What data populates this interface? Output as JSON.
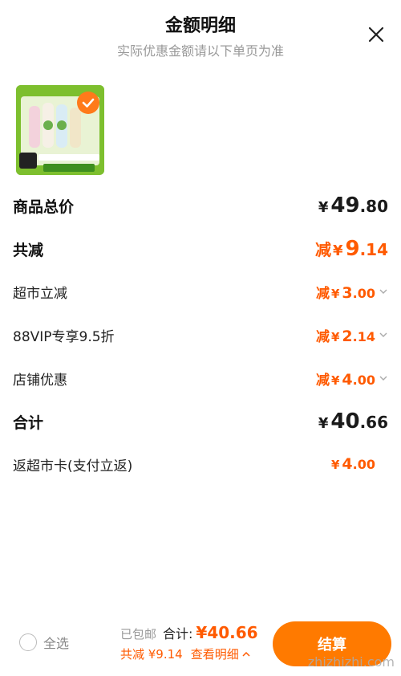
{
  "header": {
    "title": "金额明细",
    "subtitle": "实际优惠金额请以下单页为准"
  },
  "icons": {
    "close": "close-icon",
    "check": "check-icon",
    "chevron": "chevron-down-icon",
    "view_details_chevron": "chevron-up-icon"
  },
  "colors": {
    "accent": "#ff5a00",
    "button": "#ff7a00",
    "thumb_bg": "#7dbf2e"
  },
  "rows": {
    "subtotal": {
      "label": "商品总价",
      "currency": "¥",
      "int": "49",
      "dec": ".80"
    },
    "discount_total": {
      "label": "共减",
      "prefix": "减",
      "currency": "¥",
      "int": "9",
      "dec": ".14"
    },
    "supermarket": {
      "label": "超市立减",
      "prefix": "减",
      "currency": "¥",
      "int": "3",
      "dec": ".00"
    },
    "vip": {
      "label": "88VIP专享9.5折",
      "prefix": "减",
      "currency": "¥",
      "int": "2",
      "dec": ".14"
    },
    "store": {
      "label": "店铺优惠",
      "prefix": "减",
      "currency": "¥",
      "int": "4",
      "dec": ".00"
    },
    "total": {
      "label": "合计",
      "currency": "¥",
      "int": "40",
      "dec": ".66"
    },
    "cashback": {
      "label": "返超市卡(支付立返)",
      "currency": "¥",
      "int": "4",
      "dec": ".00"
    }
  },
  "footer": {
    "select_all_label": "全选",
    "shipping": "已包邮",
    "total_label": "合计:",
    "total_value": "¥40.66",
    "savings": "共减 ¥9.14",
    "view_details": "查看明细",
    "checkout_label": "结算"
  },
  "watermark": "zhizhizhi.com"
}
